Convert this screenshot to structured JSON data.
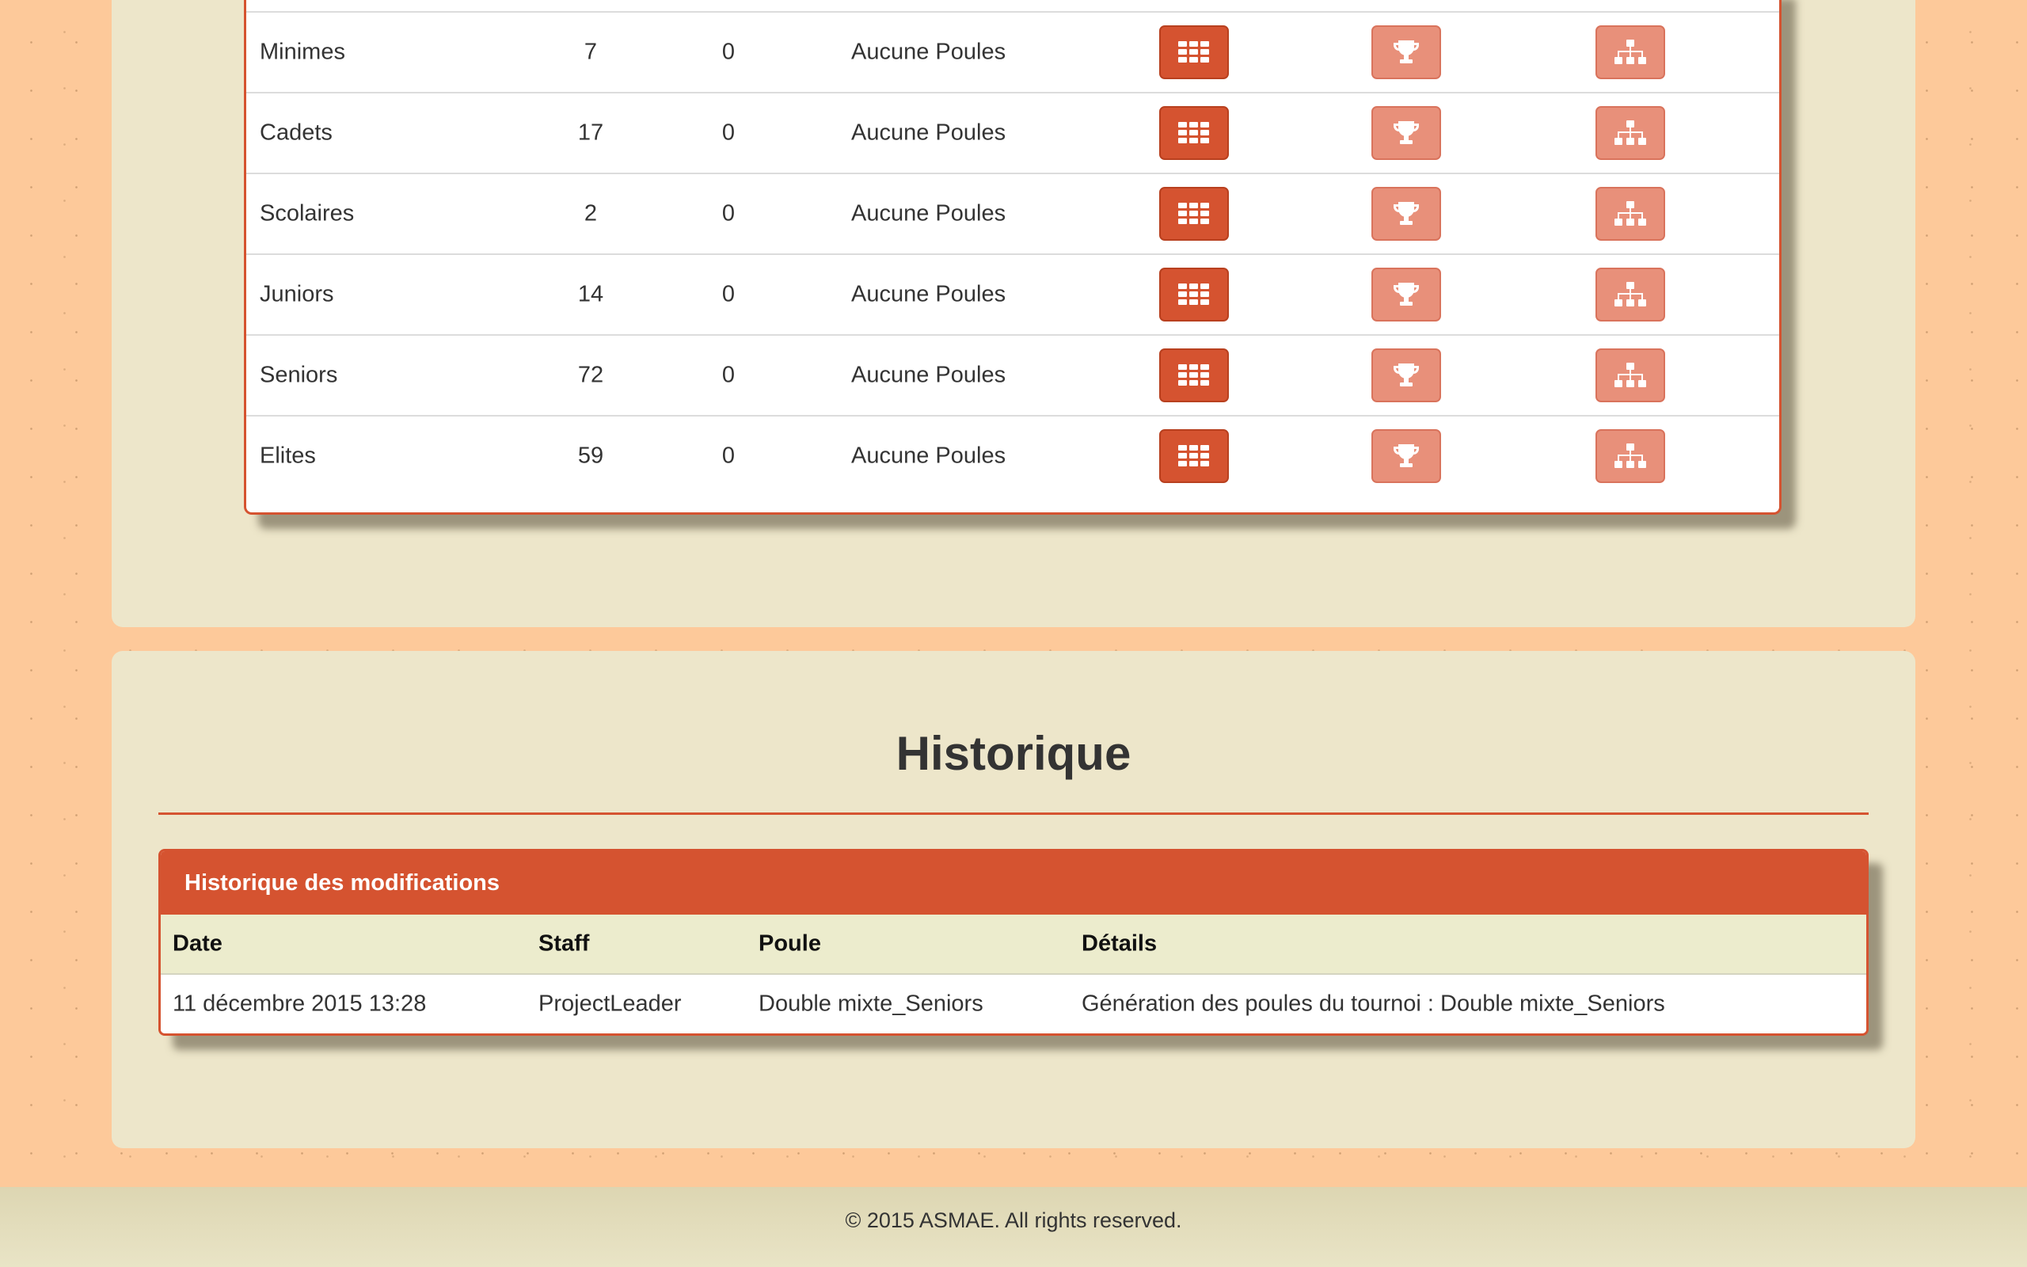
{
  "categories": [
    {
      "name": "Minimes",
      "count": "7",
      "second": "0",
      "poules": "Aucune Poules"
    },
    {
      "name": "Cadets",
      "count": "17",
      "second": "0",
      "poules": "Aucune Poules"
    },
    {
      "name": "Scolaires",
      "count": "2",
      "second": "0",
      "poules": "Aucune Poules"
    },
    {
      "name": "Juniors",
      "count": "14",
      "second": "0",
      "poules": "Aucune Poules"
    },
    {
      "name": "Seniors",
      "count": "72",
      "second": "0",
      "poules": "Aucune Poules"
    },
    {
      "name": "Elites",
      "count": "59",
      "second": "0",
      "poules": "Aucune Poules"
    }
  ],
  "actions": {
    "grid_icon": "grid-icon",
    "trophy_icon": "trophy-icon",
    "tree_icon": "sitemap-icon"
  },
  "colors": {
    "accent": "#d55330",
    "accent_light": "#e8907a",
    "card": "#ede6ca",
    "page_bg": "#fdc99a"
  },
  "historique": {
    "title": "Historique",
    "panel_title": "Historique des modifications",
    "columns": [
      "Date",
      "Staff",
      "Poule",
      "Détails"
    ],
    "rows": [
      [
        "11 décembre 2015 13:28",
        "ProjectLeader",
        "Double mixte_Seniors",
        "Génération des poules du tournoi : Double mixte_Seniors"
      ]
    ]
  },
  "footer": {
    "copyright": "© 2015 ASMAE. All rights reserved."
  }
}
